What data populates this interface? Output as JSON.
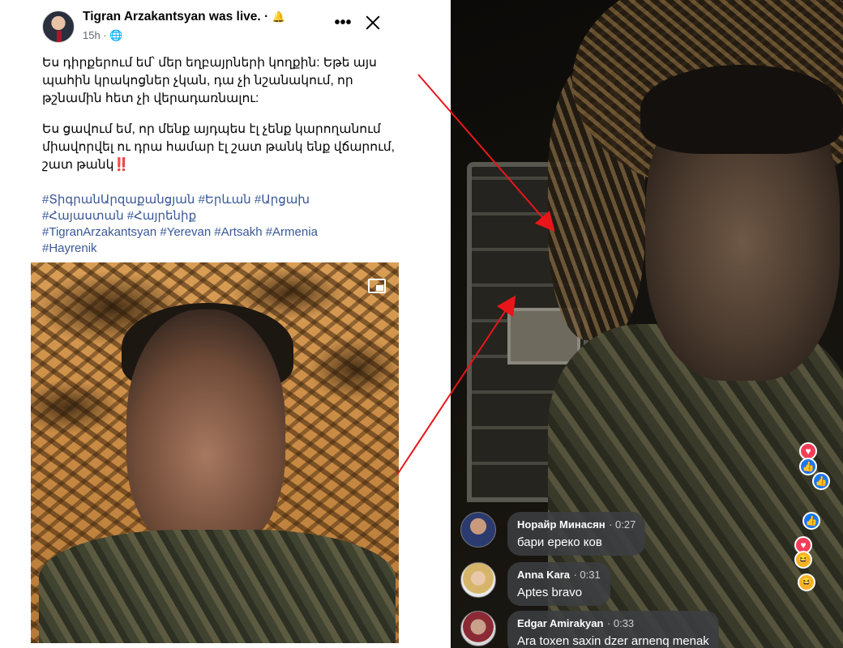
{
  "post": {
    "author": "Tigran Arzakantsyan was live. ·",
    "bell_icon": "🔔",
    "time": "15h · 🌐",
    "more_icon": "•••",
    "paragraph1": "Ես դիրքերում եմ՝ մեր եղբայրների կողքին: Եթե այս պահին կրակոցներ չկան, դա չի նշանակում, որ թշնամին հետ չի վերադառնալու:",
    "paragraph2": "Ես ցավում եմ, որ մենք այդպես էլ չենք կարողանում միավորվել ու դրա համար էլ շատ թանկ ենք վճարում, շատ թանկ",
    "exclamation": "‼️",
    "hashtags": [
      "#ՏիգրանԱրզաքանցյան #Երևան #Արցախ",
      "#Հայաստան #Հայրենիք",
      "#TigranArzakantsyan #Yerevan #Artsakh #Armenia",
      "#Hayrenik"
    ]
  },
  "live": {
    "comments": [
      {
        "name": "Норайр Минасян",
        "time": "· 0:27",
        "text": "бари ереко ков"
      },
      {
        "name": "Anna  Kara",
        "time": "· 0:31",
        "text": "Aptes bravo"
      },
      {
        "name": "Edgar Amirakyan",
        "time": "· 0:33",
        "text": "Ara toxen saxin dzer arnenq menak"
      }
    ]
  },
  "colors": {
    "hashtag": "#385898",
    "arrow": "#e8161b",
    "like": "#1877f2",
    "love": "#f33e58"
  }
}
